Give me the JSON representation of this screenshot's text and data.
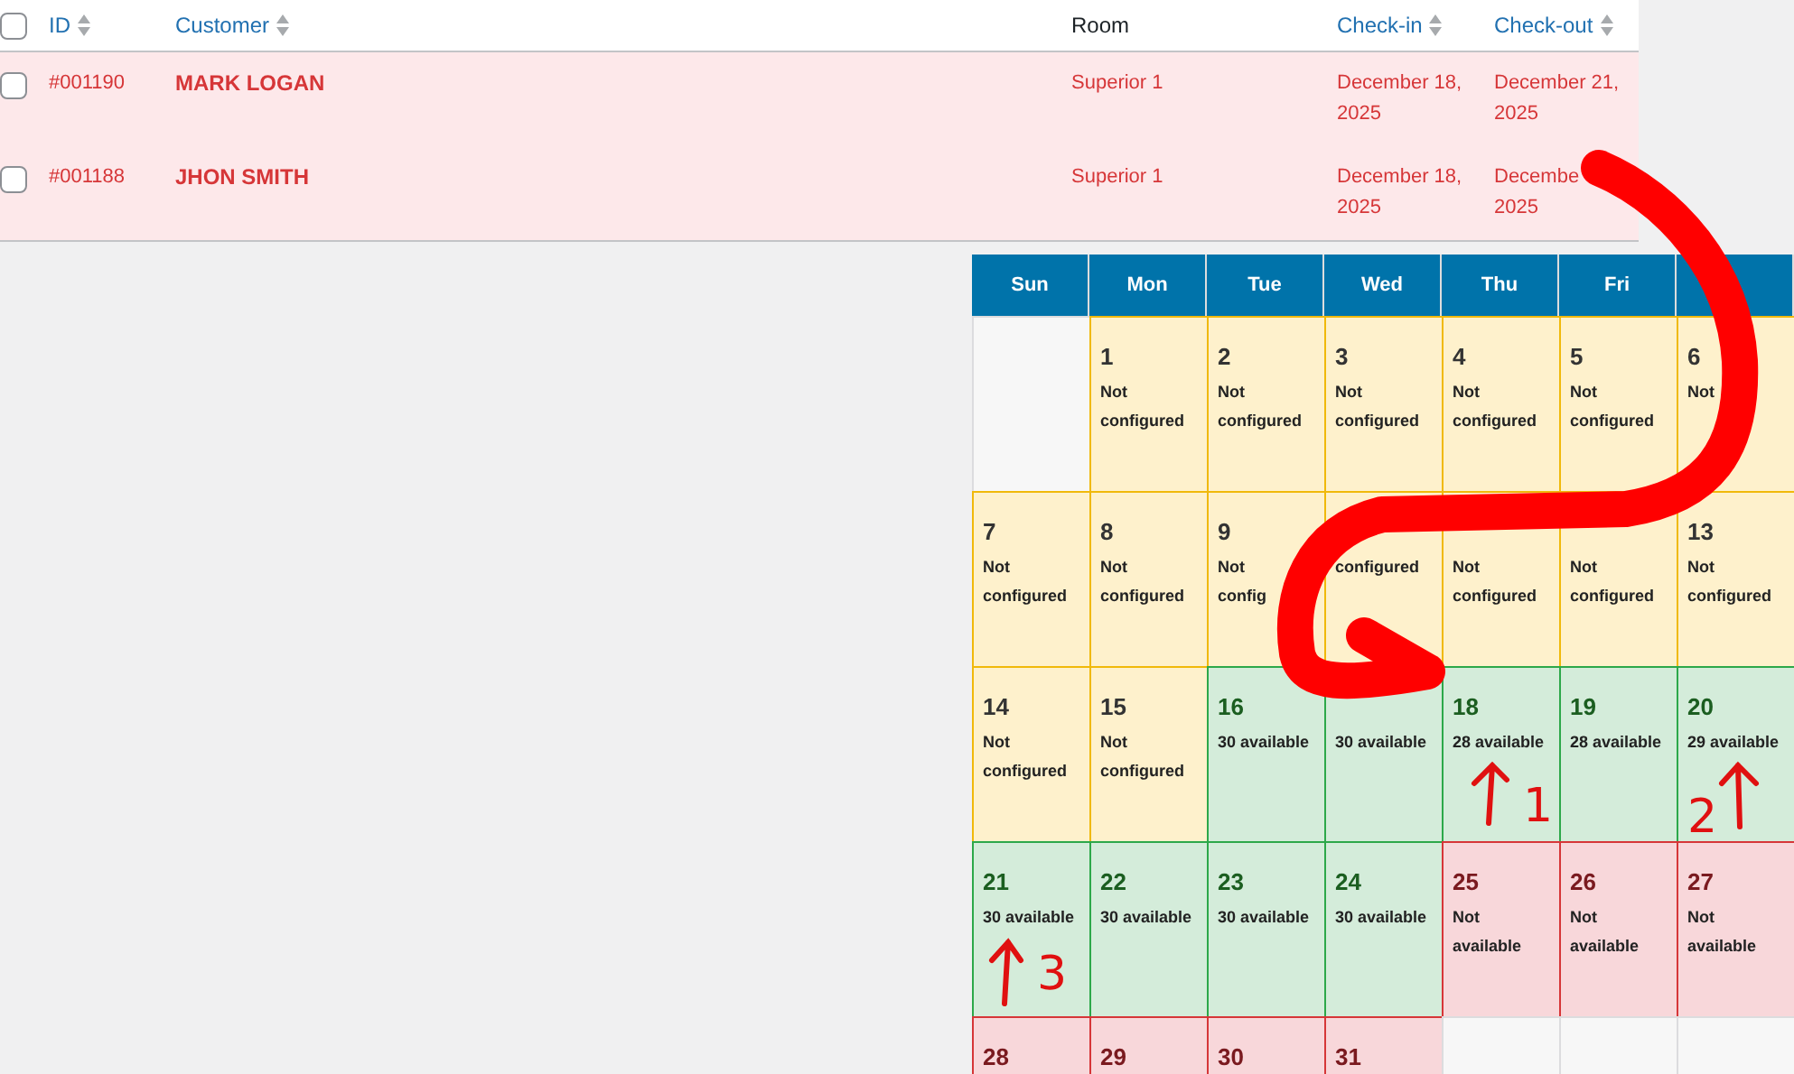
{
  "table": {
    "select_all": {
      "checked": false
    },
    "columns": [
      {
        "label": "ID",
        "sortable": true
      },
      {
        "label": "Customer",
        "sortable": true
      },
      {
        "label": "Room",
        "sortable": false
      },
      {
        "label": "Check-in",
        "sortable": true
      },
      {
        "label": "Check-out",
        "sortable": true
      }
    ],
    "rows": [
      {
        "checked": false,
        "id": "#001190",
        "customer": "MARK LOGAN",
        "room": "Superior 1",
        "check_in": [
          "December 18,",
          "2025"
        ],
        "check_out": [
          "December 21,",
          "2025"
        ]
      },
      {
        "checked": false,
        "id": "#001188",
        "customer": "JHON SMITH",
        "room": "Superior 1",
        "check_in": [
          "December 18,",
          "2025"
        ],
        "check_out": [
          "Decembe",
          "2025"
        ]
      }
    ]
  },
  "calendar": {
    "weekdays": [
      "Sun",
      "Mon",
      "Tue",
      "Wed",
      "Thu",
      "Fri"
    ],
    "weeks": [
      [
        {
          "kind": "empty"
        },
        {
          "kind": "unconfigured",
          "day": "1",
          "status": [
            "Not",
            "configured"
          ]
        },
        {
          "kind": "unconfigured",
          "day": "2",
          "status": [
            "Not",
            "configured"
          ]
        },
        {
          "kind": "unconfigured",
          "day": "3",
          "status": [
            "Not",
            "configured"
          ]
        },
        {
          "kind": "unconfigured",
          "day": "4",
          "status": [
            "Not",
            "configured"
          ]
        },
        {
          "kind": "unconfigured",
          "day": "5",
          "status": [
            "Not",
            "configured"
          ]
        },
        {
          "kind": "unconfigured",
          "day": "6",
          "status": [
            "Not"
          ]
        }
      ],
      [
        {
          "kind": "unconfigured",
          "day": "7",
          "status": [
            "Not",
            "configured"
          ]
        },
        {
          "kind": "unconfigured",
          "day": "8",
          "status": [
            "Not",
            "configured"
          ]
        },
        {
          "kind": "unconfigured",
          "day": "9",
          "status": [
            "Not",
            "config"
          ]
        },
        {
          "kind": "unconfigured",
          "status": [
            "configured"
          ]
        },
        {
          "kind": "unconfigured",
          "status": [
            "Not",
            "configured"
          ]
        },
        {
          "kind": "unconfigured",
          "status": [
            "Not",
            "configured"
          ]
        },
        {
          "kind": "unconfigured",
          "day": "13",
          "status": [
            "Not",
            "configured"
          ]
        }
      ],
      [
        {
          "kind": "unconfigured",
          "day": "14",
          "status": [
            "Not",
            "configured"
          ]
        },
        {
          "kind": "unconfigured",
          "day": "15",
          "status": [
            "Not",
            "configured"
          ]
        },
        {
          "kind": "available",
          "day": "16",
          "status": [
            "30 available"
          ]
        },
        {
          "kind": "available",
          "status": [
            "30 available"
          ]
        },
        {
          "kind": "available",
          "day": "18",
          "status": [
            "28 available"
          ]
        },
        {
          "kind": "available",
          "day": "19",
          "status": [
            "28 available"
          ]
        },
        {
          "kind": "available",
          "day": "20",
          "status": [
            "29 available"
          ]
        }
      ],
      [
        {
          "kind": "available",
          "day": "21",
          "status": [
            "30 available"
          ]
        },
        {
          "kind": "available",
          "day": "22",
          "status": [
            "30 available"
          ]
        },
        {
          "kind": "available",
          "day": "23",
          "status": [
            "30 available"
          ]
        },
        {
          "kind": "available",
          "day": "24",
          "status": [
            "30 available"
          ]
        },
        {
          "kind": "unavailable",
          "day": "25",
          "status": [
            "Not",
            "available"
          ]
        },
        {
          "kind": "unavailable",
          "day": "26",
          "status": [
            "Not",
            "available"
          ]
        },
        {
          "kind": "unavailable",
          "day": "27",
          "status": [
            "Not",
            "available"
          ]
        }
      ],
      [
        {
          "kind": "unavailable",
          "day": "28"
        },
        {
          "kind": "unavailable",
          "day": "29"
        },
        {
          "kind": "unavailable",
          "day": "30"
        },
        {
          "kind": "unavailable",
          "day": "31"
        },
        {
          "kind": "empty"
        },
        {
          "kind": "empty"
        },
        {
          "kind": "empty"
        }
      ]
    ]
  },
  "annotations": {
    "labels": [
      "1",
      "2",
      "3"
    ]
  }
}
